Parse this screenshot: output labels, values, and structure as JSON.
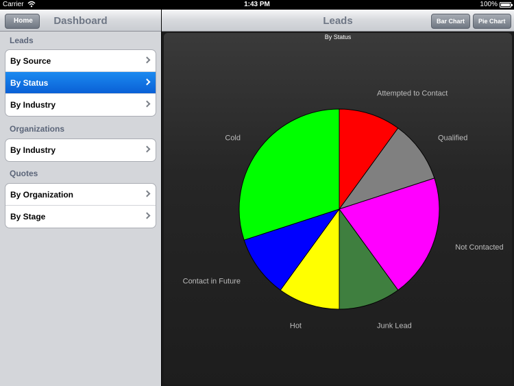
{
  "status_bar": {
    "carrier": "Carrier",
    "time": "1:43 PM",
    "battery": "100%"
  },
  "master": {
    "home_button": "Home",
    "title": "Dashboard",
    "sections": [
      {
        "title": "Leads",
        "items": [
          "By Source",
          "By Status",
          "By Industry"
        ]
      },
      {
        "title": "Organizations",
        "items": [
          "By Industry"
        ]
      },
      {
        "title": "Quotes",
        "items": [
          "By Organization",
          "By Stage"
        ]
      }
    ],
    "selected": "By Status"
  },
  "detail": {
    "title": "Leads",
    "bar_chart_button": "Bar Chart",
    "pie_chart_button": "Pie Chart"
  },
  "chart_data": {
    "type": "pie",
    "title": "By Status",
    "slices": [
      {
        "label": "Attempted to Contact",
        "value": 3,
        "color": "#ff0000"
      },
      {
        "label": "Qualified",
        "value": 3,
        "color": "#808080"
      },
      {
        "label": "Not Contacted",
        "value": 6,
        "color": "#ff00ff"
      },
      {
        "label": "Junk Lead",
        "value": 3,
        "color": "#3f7f3f"
      },
      {
        "label": "Hot",
        "value": 3,
        "color": "#ffff00"
      },
      {
        "label": "Contact in Future",
        "value": 3,
        "color": "#0000ff"
      },
      {
        "label": "Cold",
        "value": 9,
        "color": "#00ff00"
      }
    ]
  }
}
